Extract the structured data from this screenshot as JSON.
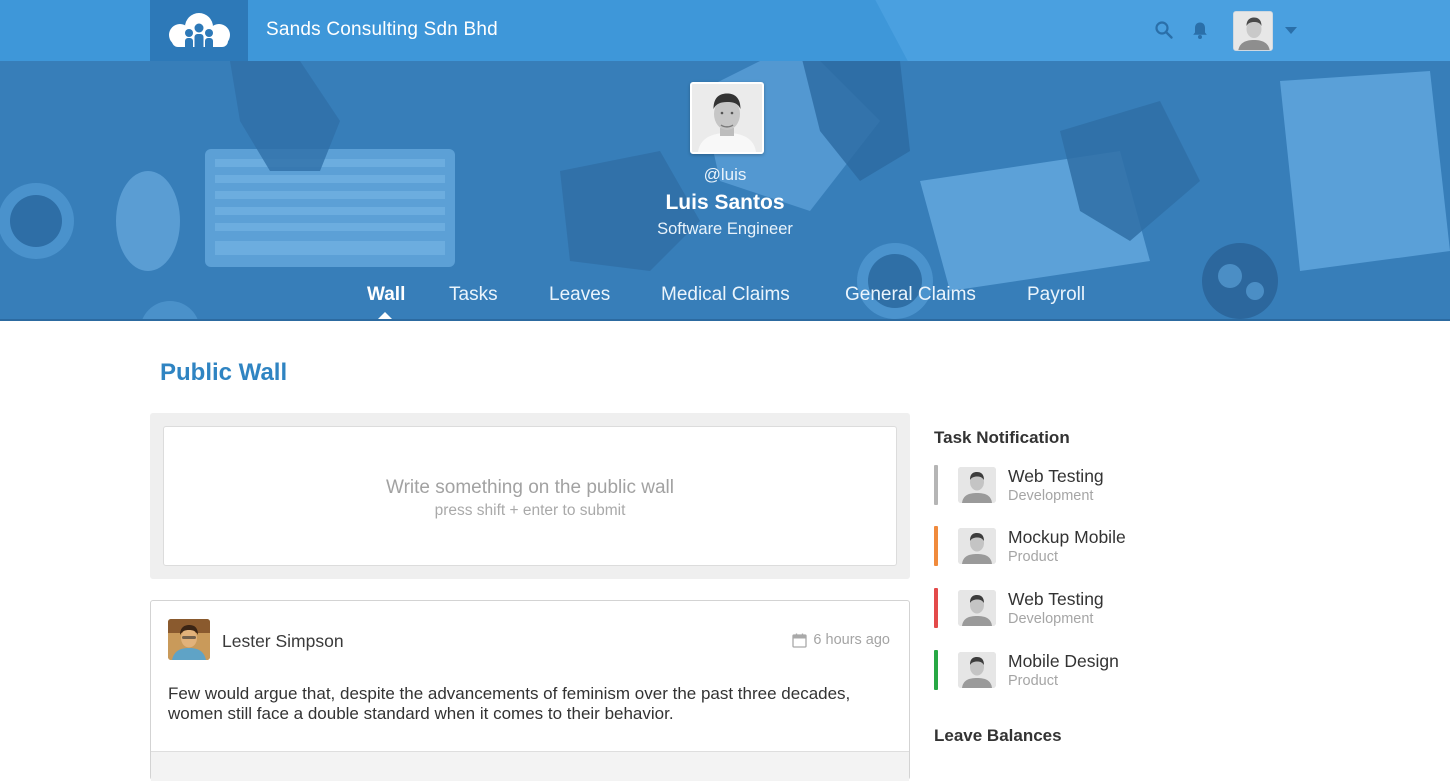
{
  "header": {
    "company_name": "Sands Consulting Sdn Bhd",
    "logo_icon": "cloud-people-logo",
    "search_icon": "search-icon",
    "notification_icon": "bell-icon",
    "user_menu_icon": "chevron-down-icon"
  },
  "profile": {
    "handle": "@luis",
    "name": "Luis Santos",
    "title": "Software Engineer"
  },
  "nav": {
    "tabs": [
      {
        "label": "Wall",
        "active": true
      },
      {
        "label": "Tasks",
        "active": false
      },
      {
        "label": "Leaves",
        "active": false
      },
      {
        "label": "Medical Claims",
        "active": false
      },
      {
        "label": "General Claims",
        "active": false
      },
      {
        "label": "Payroll",
        "active": false
      }
    ]
  },
  "main": {
    "title": "Public Wall",
    "composer": {
      "placeholder": "Write something on the public wall",
      "hint": "press shift + enter to submit"
    },
    "posts": [
      {
        "author": "Lester Simpson",
        "time": "6 hours ago",
        "time_icon": "calendar-icon",
        "body": "Few would argue that, despite the advancements of feminism over the past three decades, women still face a double standard when it comes to their behavior."
      }
    ]
  },
  "sidebar": {
    "task_heading": "Task Notification",
    "tasks": [
      {
        "name": "Web Testing",
        "department": "Development",
        "color": "#b5b5b5"
      },
      {
        "name": "Mockup Mobile",
        "department": "Product",
        "color": "#f08a3c"
      },
      {
        "name": "Web Testing",
        "department": "Development",
        "color": "#e34a4a"
      },
      {
        "name": "Mobile Design",
        "department": "Product",
        "color": "#27a844"
      }
    ],
    "leave_heading": "Leave Balances"
  },
  "colors": {
    "brand_blue": "#3e97d9",
    "title_blue": "#2f84c2"
  }
}
